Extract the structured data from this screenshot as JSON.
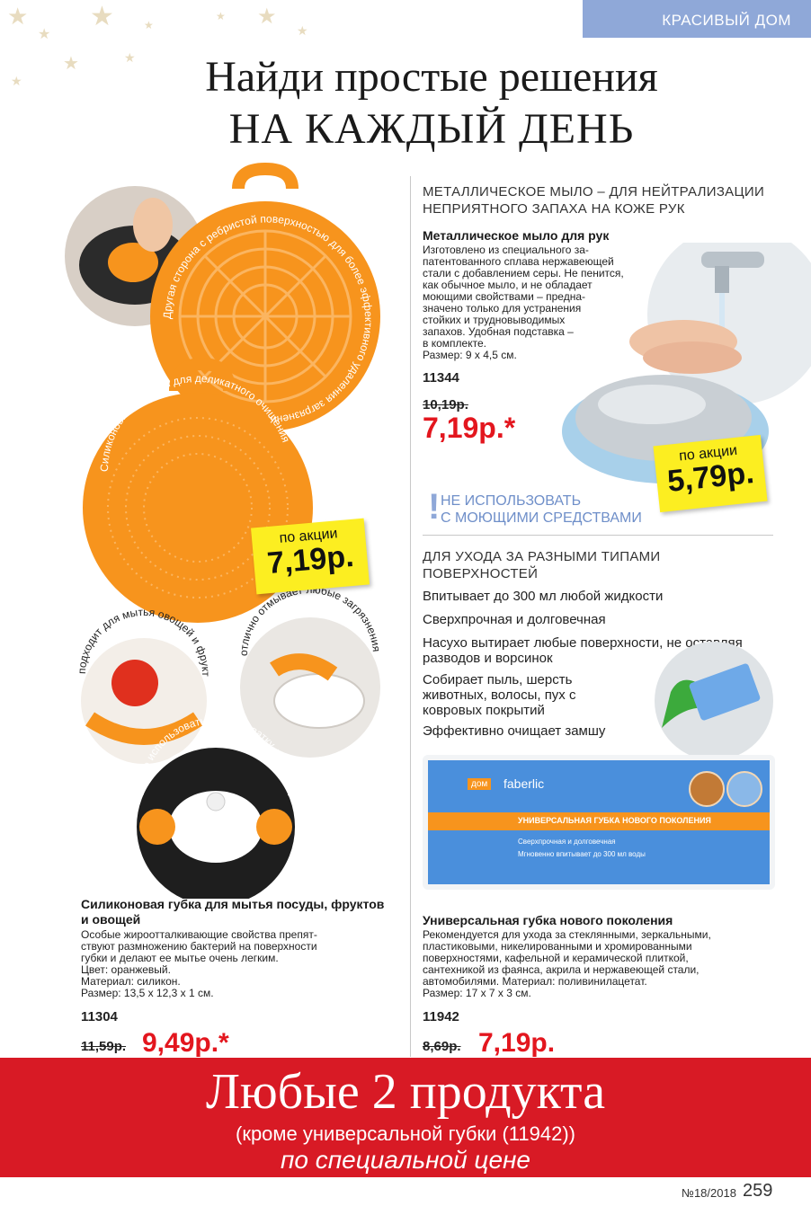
{
  "header": {
    "section": "КРАСИВЫЙ ДОМ",
    "headline_line1": "Найди простые решения",
    "headline_line2": "НА КАЖДЫЙ ДЕНЬ"
  },
  "sponge": {
    "curve_text_1": "Другая сторона с ребристой поверхностью для более эффективного удаления загрязнений",
    "curve_text_2": "Силиконовые щетинки для деликатного очищения",
    "curve_text_3": "подходит для мытья овощей и фруктов",
    "curve_text_4": "отлично отмывает любые загрязнения",
    "curve_text_5": "можно использовать как прихватку для горячего",
    "promo_label": "по акции",
    "promo_price": "7,19р.",
    "name": "Силиконовая губка для мытья посуды, фруктов и овощей",
    "desc_lines": [
      "Особые жироотталкивающие свойства препят-",
      "ствуют размножению бактерий на поверхности",
      "губки и делают ее мытье очень легким.",
      "Цвет: оранжевый.",
      "Материал: силикон.",
      "Размер: 13,5 х 12,3 х 1 см."
    ],
    "sku": "11304",
    "old_price": "11,59р.",
    "new_price": "9,49р.*"
  },
  "soap": {
    "category_line1": "МЕТАЛЛИЧЕСКОЕ МЫЛО – ДЛЯ НЕЙТРАЛИЗАЦИИ",
    "category_line2": "НЕПРИЯТНОГО ЗАПАХА НА КОЖЕ РУК",
    "name": "Металлическое мыло для рук",
    "desc_lines": [
      "Изготовлено из специального за-",
      "патентованного сплава нержавеющей",
      "стали с добавлением серы. Не пенится,",
      "как обычное мыло, и не обладает",
      "моющими свойствами – предна-",
      "значено только для устранения",
      "стойких и трудновыводимых",
      "запахов. Удобная подставка –",
      "в комплекте.",
      "Размер: 9 х 4,5 см."
    ],
    "sku": "11344",
    "old_price": "10,19р.",
    "new_price": "7,19р.*",
    "promo_label": "по акции",
    "promo_price": "5,79р.",
    "warning_mark": "!",
    "warning_line1": "НЕ ИСПОЛЬЗОВАТЬ",
    "warning_line2": "С МОЮЩИМИ СРЕДСТВАМИ"
  },
  "universal": {
    "category_line1": "ДЛЯ УХОДА ЗА РАЗНЫМИ ТИПАМИ",
    "category_line2": "ПОВЕРХНОСТЕЙ",
    "features": [
      "Впитывает до 300 мл любой жидкости",
      "Сверхпрочная и долговечная",
      "Насухо вытирает любые поверхности, не оставляя разводов и ворсинок",
      "Собирает пыль, шерсть животных, волосы, пух с ковровых покрытий",
      "Эффективно очищает замшу"
    ],
    "package_brand_small": "дом",
    "package_brand": "faberlic",
    "package_title": "УНИВЕРСАЛЬНАЯ ГУБКА НОВОГО ПОКОЛЕНИЯ",
    "package_line1": "Сверхпрочная и долговечная",
    "package_line2": "Мгновенно впитывает до 300 мл воды",
    "name": "Универсальная губка нового поколения",
    "desc_lines": [
      "Рекомендуется для ухода за стеклянными, зеркальными,",
      "пластиковыми, никелированными и хромированными",
      "поверхностями, кафельной и керамической плиткой,",
      "сантехникой из фаянса, акрила и нержавеющей стали,",
      "автомобилями. Материал: поливинилацетат.",
      "Размер: 17 х 7 х 3 см."
    ],
    "sku": "11942",
    "old_price": "8,69р.",
    "new_price": "7,19р."
  },
  "banner": {
    "line1": "Любые 2 продукта",
    "line2": "(кроме универсальной губки (11942))",
    "line3": "по специальной цене"
  },
  "footer": {
    "issue": "№18/2018",
    "page": "259"
  },
  "colors": {
    "accent_red": "#e3161e",
    "banner_red": "#d81a25",
    "section_blue": "#8fa8d8",
    "promo_yellow": "#fcee21",
    "sponge_orange": "#f7941d",
    "package_blue": "#4a90d9"
  }
}
